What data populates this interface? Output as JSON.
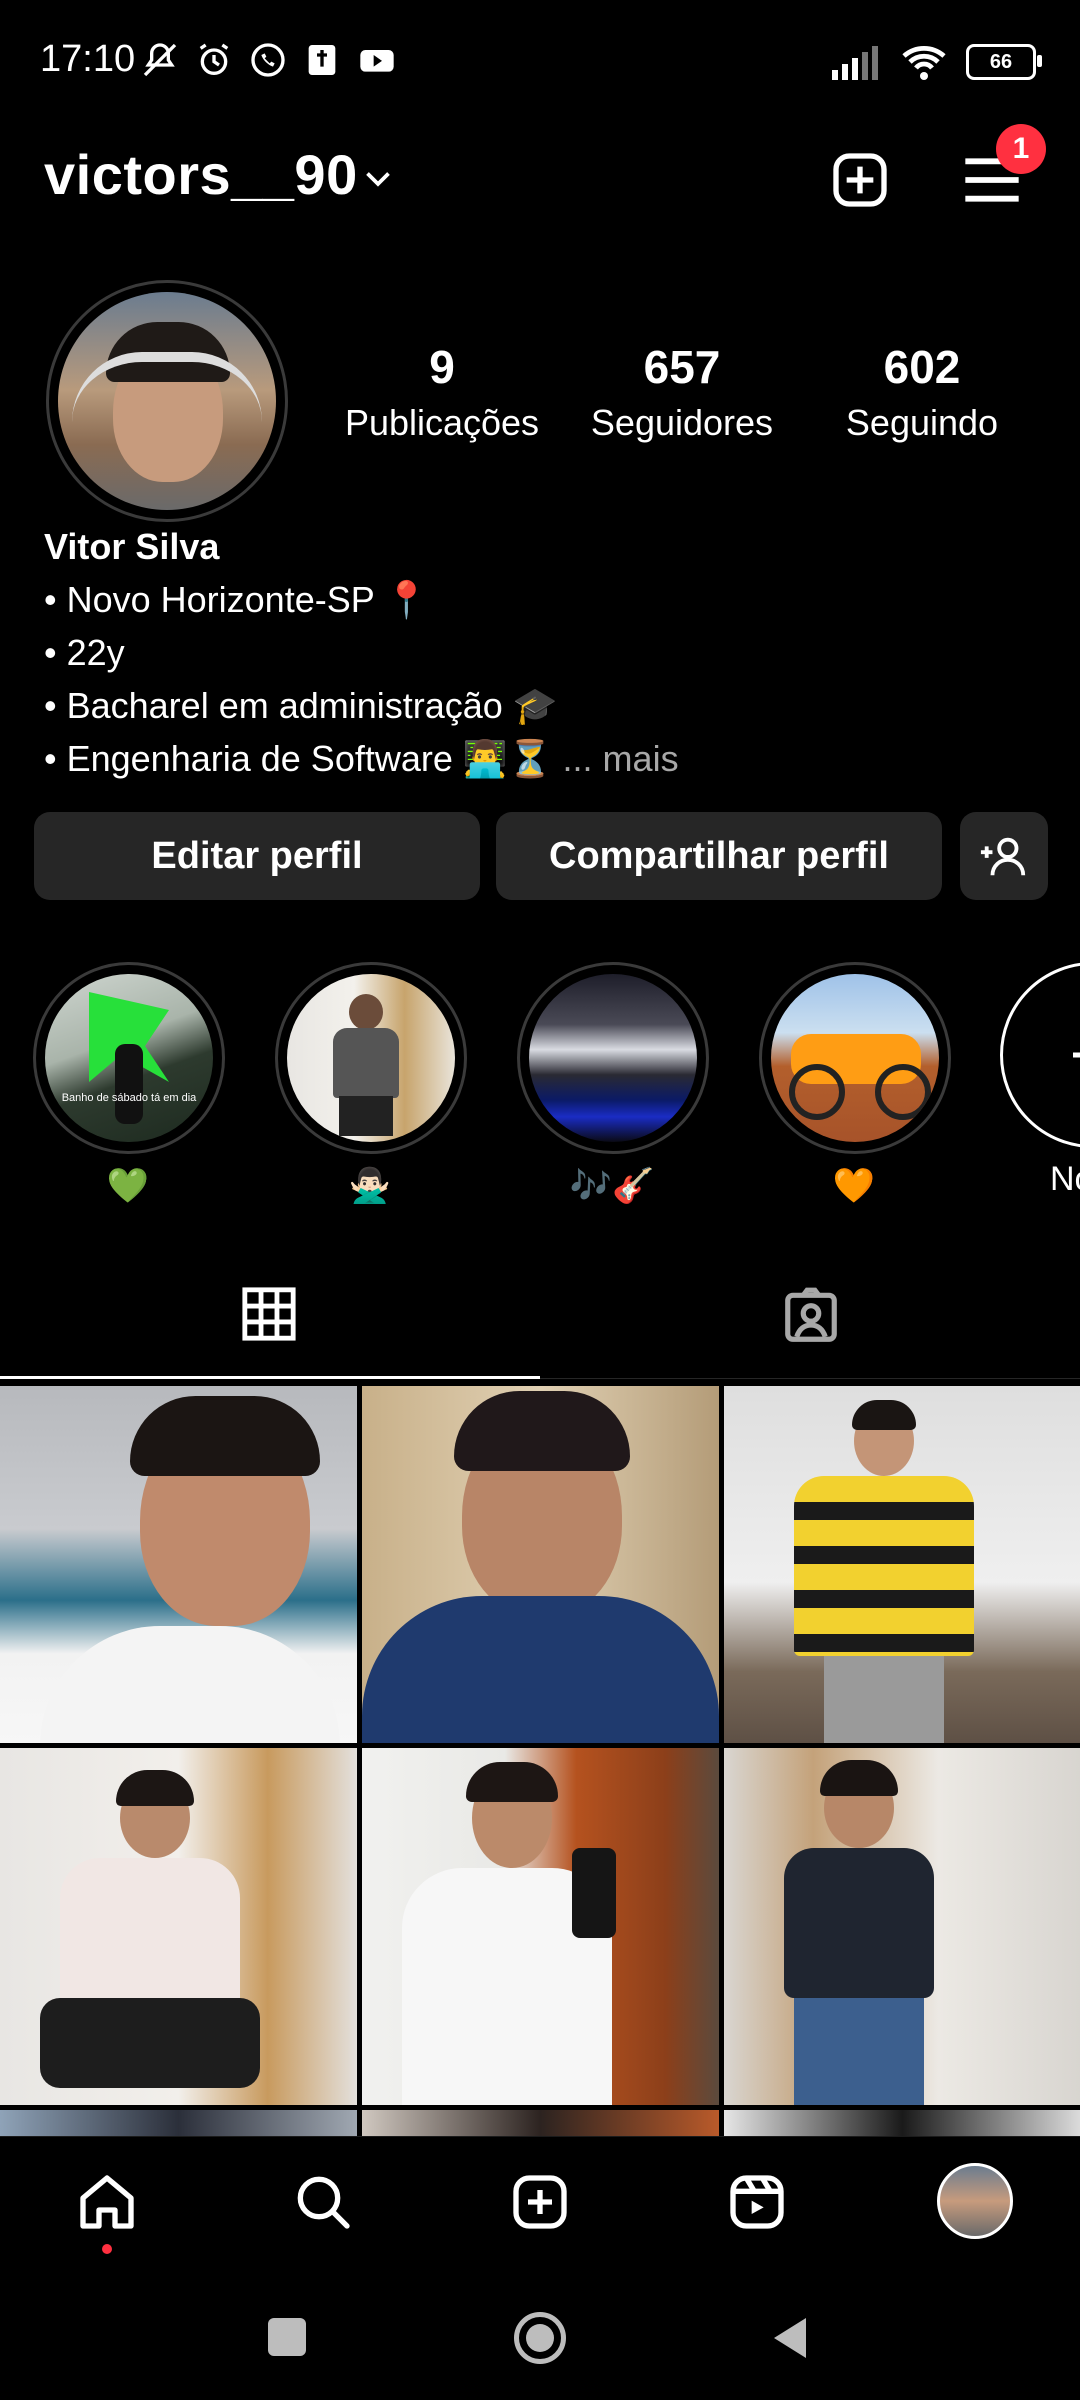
{
  "status_bar": {
    "time": "17:10",
    "battery": "66"
  },
  "header": {
    "username": "victors__90",
    "notification_count": "1"
  },
  "profile": {
    "stats": [
      {
        "value": "9",
        "label": "Publicações"
      },
      {
        "value": "657",
        "label": "Seguidores"
      },
      {
        "value": "602",
        "label": "Seguindo"
      }
    ],
    "name": "Vitor Silva",
    "bio": [
      "• Novo Horizonte-SP 📍",
      "• 22y",
      "• Bacharel em administração 🎓",
      "• Engenharia de Software 👨‍💻⏳"
    ],
    "more_label": "... mais"
  },
  "buttons": {
    "edit": "Editar perfil",
    "share": "Compartilhar perfil"
  },
  "highlights": [
    {
      "label": "💚"
    },
    {
      "label": "🙅🏻‍♂️"
    },
    {
      "label": "🎶🎸"
    },
    {
      "label": "🧡"
    },
    {
      "label": "No"
    }
  ],
  "highlight_texts": {
    "moto": "Banho de sábado tá em dia"
  },
  "tabs": [
    "grid",
    "tagged"
  ],
  "colors": {
    "accent": "#ff3040",
    "button_bg": "#262626",
    "background": "#000000"
  },
  "icons": [
    "mute-bell-icon",
    "alarm-icon",
    "whatsapp-icon",
    "bible-icon",
    "youtube-icon",
    "signal-icon",
    "wifi-icon",
    "battery-icon",
    "chevron-down-icon",
    "plus-square-icon",
    "hamburger-menu-icon",
    "add-person-icon",
    "grid-icon",
    "tagged-icon",
    "home-icon",
    "search-icon",
    "create-icon",
    "reels-icon",
    "avatar-icon"
  ]
}
